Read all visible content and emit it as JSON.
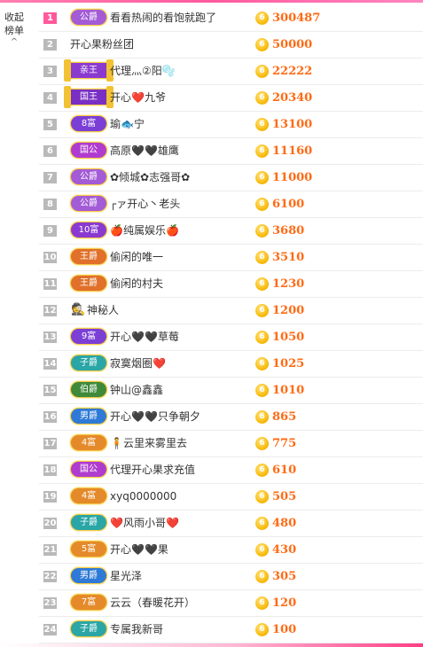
{
  "collapse": {
    "label_line1": "收起",
    "label_line2": "榜单",
    "icon": "chevron-up-icon"
  },
  "colors": {
    "accent": "#ff5a9a",
    "amount": "#ff6a13",
    "coin": "#f7b500"
  },
  "coin_glyph": "6",
  "rows": [
    {
      "rank": "1",
      "badge": "公爵",
      "badge_color": "#a35bd6",
      "name": "看看热闹的看饱就跑了",
      "amount": "300487"
    },
    {
      "rank": "2",
      "badge": "",
      "badge_color": "",
      "name": "开心果粉丝团",
      "amount": "50000"
    },
    {
      "rank": "3",
      "badge": "亲王",
      "badge_color": "#8b3ad0",
      "name": "代理灬②阳🫧",
      "amount": "22222"
    },
    {
      "rank": "4",
      "badge": "国王",
      "badge_color": "#7a2fc4",
      "name": "开心❤️九爷",
      "amount": "20340"
    },
    {
      "rank": "5",
      "badge": "8富",
      "badge_color": "#7b3fd6",
      "name": "瑜🐟宁",
      "amount": "13100"
    },
    {
      "rank": "6",
      "badge": "国公",
      "badge_color": "#b03ccf",
      "name": "高原🖤🖤雄鹰",
      "amount": "11160"
    },
    {
      "rank": "7",
      "badge": "公爵",
      "badge_color": "#a35bd6",
      "name": "✿倾城✿志强哥✿",
      "amount": "11000"
    },
    {
      "rank": "8",
      "badge": "公爵",
      "badge_color": "#a35bd6",
      "name": "┌ァ开心丶老头",
      "amount": "6100"
    },
    {
      "rank": "9",
      "badge": "10富",
      "badge_color": "#8a3ad0",
      "name": "🍎纯属娱乐🍎",
      "amount": "3680"
    },
    {
      "rank": "10",
      "badge": "王爵",
      "badge_color": "#e0702a",
      "name": "偷闲的唯一",
      "amount": "3510"
    },
    {
      "rank": "11",
      "badge": "王爵",
      "badge_color": "#e0702a",
      "name": "偷闲的村夫",
      "amount": "1230"
    },
    {
      "rank": "12",
      "badge": "",
      "badge_color": "",
      "name": "神秘人",
      "amount": "1200"
    },
    {
      "rank": "13",
      "badge": "9富",
      "badge_color": "#7b3fd6",
      "name": "开心🖤🖤草莓",
      "amount": "1050"
    },
    {
      "rank": "14",
      "badge": "子爵",
      "badge_color": "#2aa6a6",
      "name": "寂寞烟圈❤️",
      "amount": "1025"
    },
    {
      "rank": "15",
      "badge": "伯爵",
      "badge_color": "#3f8a3a",
      "name": "钟山@鑫鑫",
      "amount": "1010"
    },
    {
      "rank": "16",
      "badge": "男爵",
      "badge_color": "#2e7ad6",
      "name": "开心🖤🖤只争朝夕",
      "amount": "865"
    },
    {
      "rank": "17",
      "badge": "4富",
      "badge_color": "#e58a2a",
      "name": "🧍云里来雾里去",
      "amount": "775"
    },
    {
      "rank": "18",
      "badge": "国公",
      "badge_color": "#b03ccf",
      "name": "代理开心果求充值",
      "amount": "610"
    },
    {
      "rank": "19",
      "badge": "4富",
      "badge_color": "#e58a2a",
      "name": "xyq0000000",
      "amount": "505"
    },
    {
      "rank": "20",
      "badge": "子爵",
      "badge_color": "#2aa6a6",
      "name": "❤️风雨小哥❤️",
      "amount": "480"
    },
    {
      "rank": "21",
      "badge": "5富",
      "badge_color": "#e58a2a",
      "name": "开心🖤🖤果",
      "amount": "430"
    },
    {
      "rank": "22",
      "badge": "男爵",
      "badge_color": "#2e7ad6",
      "name": "星光泽",
      "amount": "305"
    },
    {
      "rank": "23",
      "badge": "7富",
      "badge_color": "#e58a2a",
      "name": "云云（春暖花开）",
      "amount": "120"
    },
    {
      "rank": "24",
      "badge": "子爵",
      "badge_color": "#2aa6a6",
      "name": "专属我新哥",
      "amount": "100"
    }
  ]
}
